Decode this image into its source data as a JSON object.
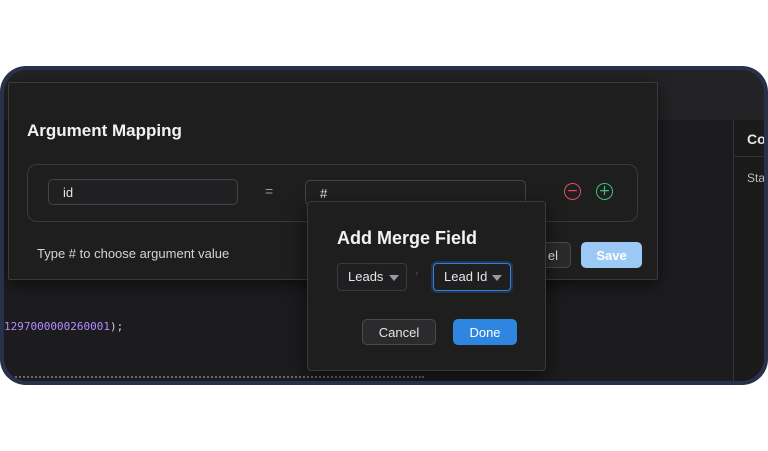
{
  "right_panel": {
    "header": "Co",
    "sub_text": "Sta"
  },
  "code": {
    "number": "1297000000260001",
    "suffix": ");"
  },
  "argument_mapping": {
    "title": "Argument Mapping",
    "row": {
      "argument_value": "id",
      "equals": "=",
      "mapped_value": "#",
      "remove_icon": "minus-circle-icon",
      "add_icon": "plus-circle-icon"
    },
    "hint": "Type # to choose argument value",
    "cancel_label": "el",
    "save_label": "Save"
  },
  "merge_field": {
    "title": "Add Merge Field",
    "module_select": "Leads",
    "separator": "›",
    "field_select": "Lead Id",
    "cancel_label": "Cancel",
    "done_label": "Done"
  },
  "colors": {
    "frame": "#27324a",
    "background": "#1c1c1e",
    "primary": "#2f86e0",
    "save_disabled": "#9bc8f5",
    "remove": "#e0505a",
    "add": "#3ec07a"
  }
}
